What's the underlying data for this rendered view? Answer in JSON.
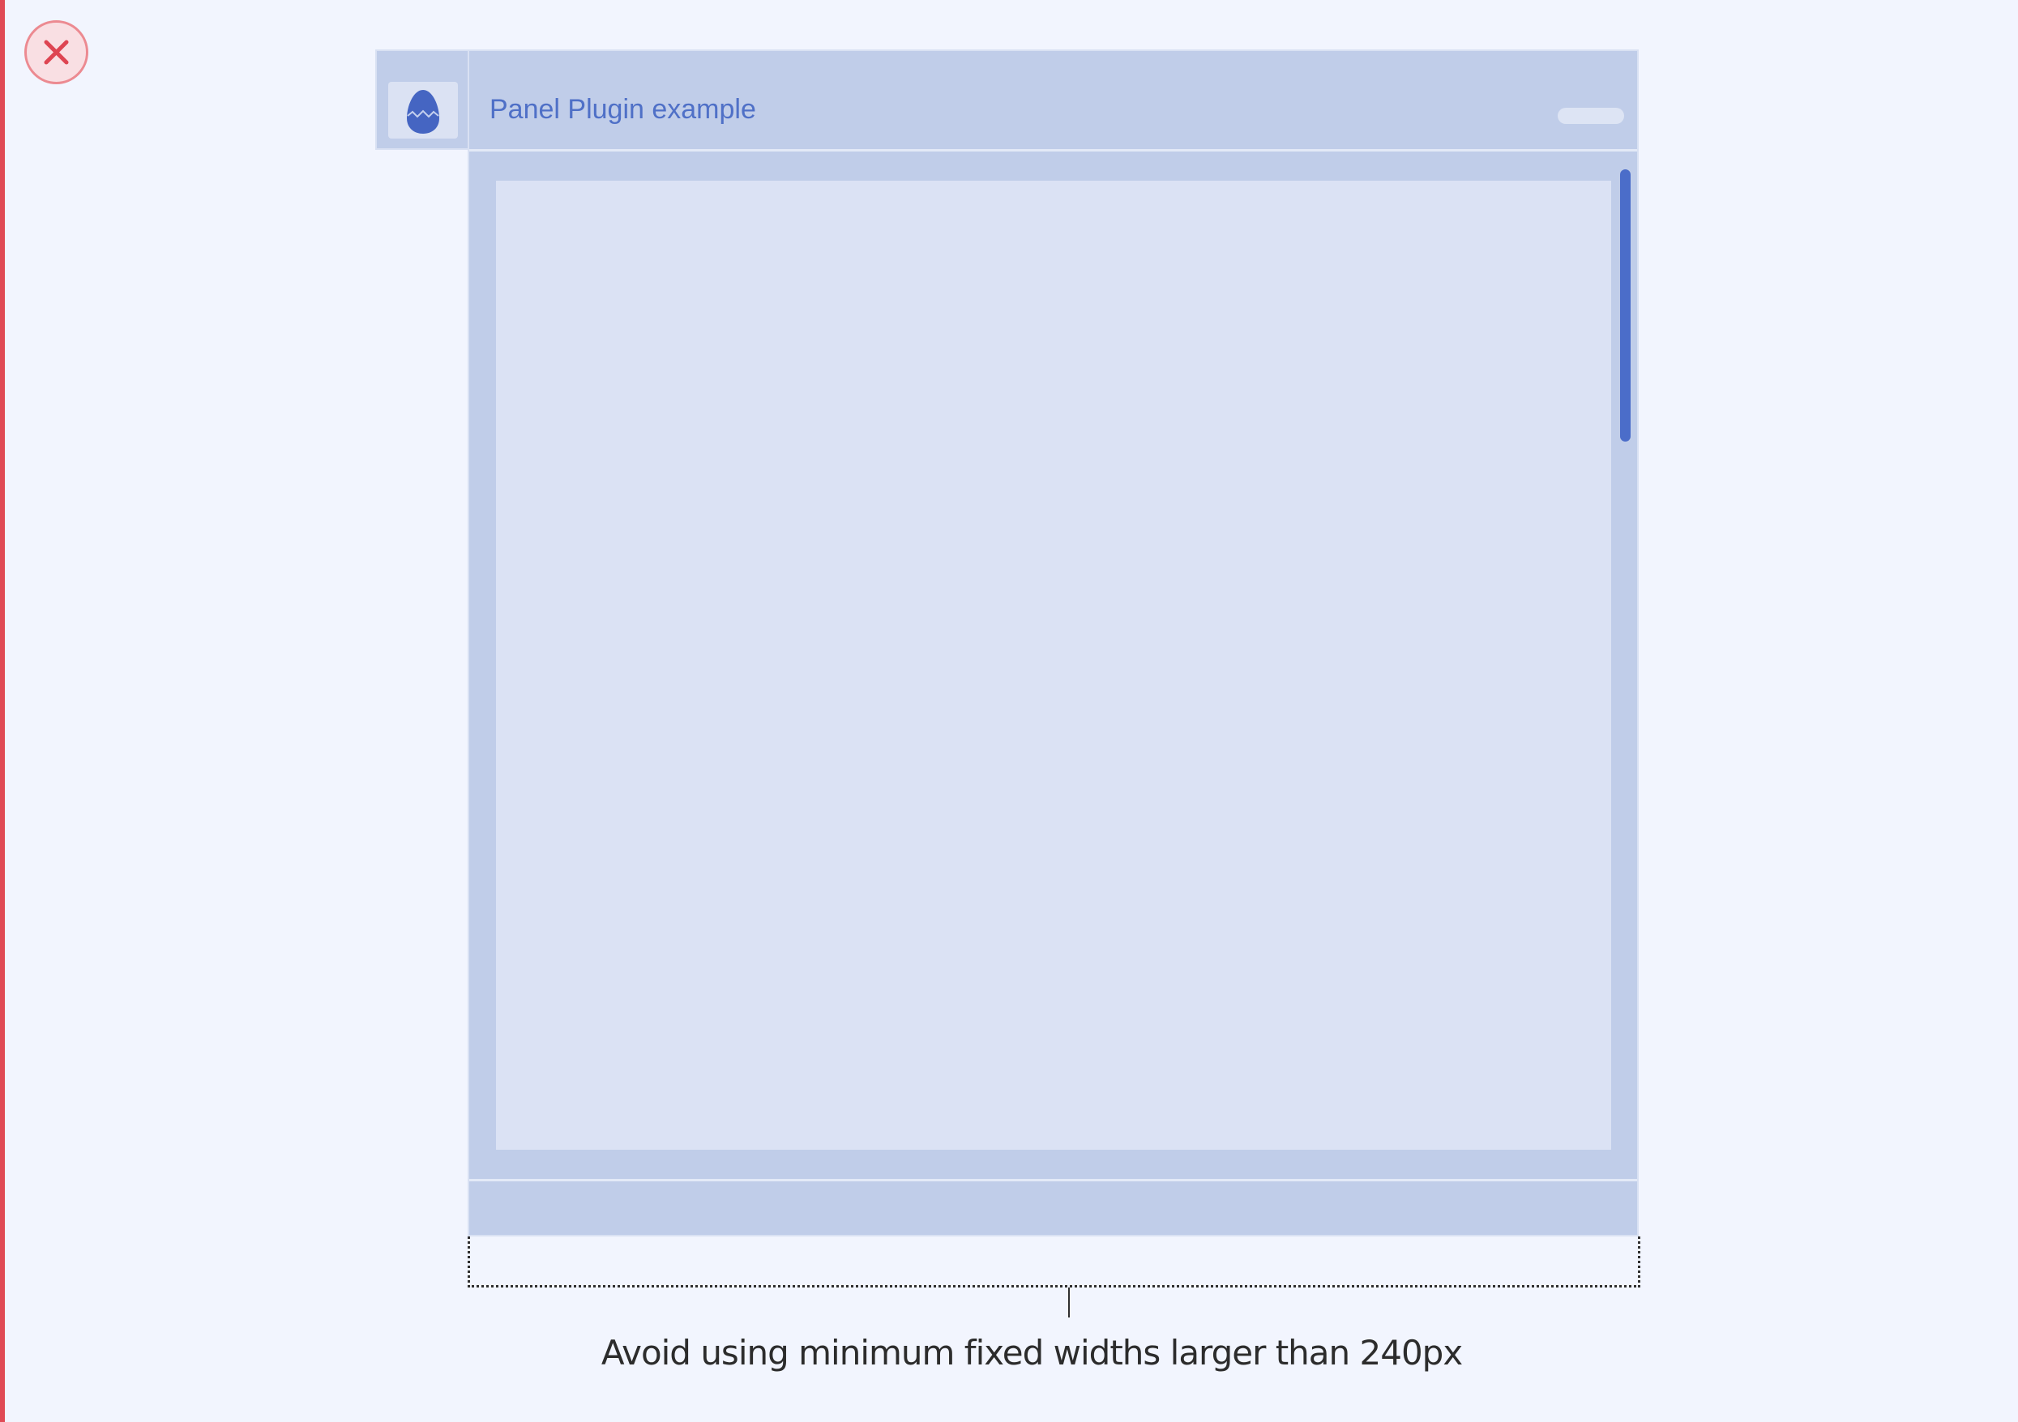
{
  "status": {
    "kind": "dont",
    "icon": "error-x-icon",
    "accent_color": "#e04a55"
  },
  "panel": {
    "title": "Panel Plugin example",
    "plugin_icon": "egg-icon",
    "accent_color": "#4b6dc9",
    "surface_color": "#c0cde9",
    "content_color": "#dbe2f4"
  },
  "annotation": {
    "caption": "Avoid using minimum fixed widths larger than 240px"
  }
}
